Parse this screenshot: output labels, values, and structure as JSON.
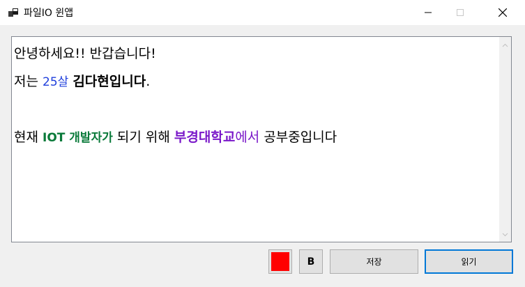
{
  "window": {
    "title": "파일IO 윈앱",
    "controls": {
      "minimize_icon": "minimize-icon",
      "maximize_icon": "maximize-icon",
      "close_icon": "close-icon"
    }
  },
  "editor": {
    "line1": "안녕하세요!! 반갑습니다!",
    "line2": {
      "prefix": "저는 ",
      "age": "25살",
      "space": " ",
      "name": "김다현입니다",
      "suffix": "."
    },
    "line3": {
      "prefix": "현재 ",
      "iot": "IOT 개발자가",
      "middle": " 되기 위해 ",
      "school": "부경대학교",
      "school_suffix": "에서",
      "suffix": " 공부중입니다"
    }
  },
  "toolbar": {
    "color_button_color": "#ff0000",
    "bold_label": "B",
    "save_label": "저장",
    "read_label": "읽기"
  },
  "colors": {
    "age_color": "#1f3fdc",
    "iot_color": "#0a7a3a",
    "school_color": "#7a18c9",
    "focus_border": "#0078d7"
  }
}
